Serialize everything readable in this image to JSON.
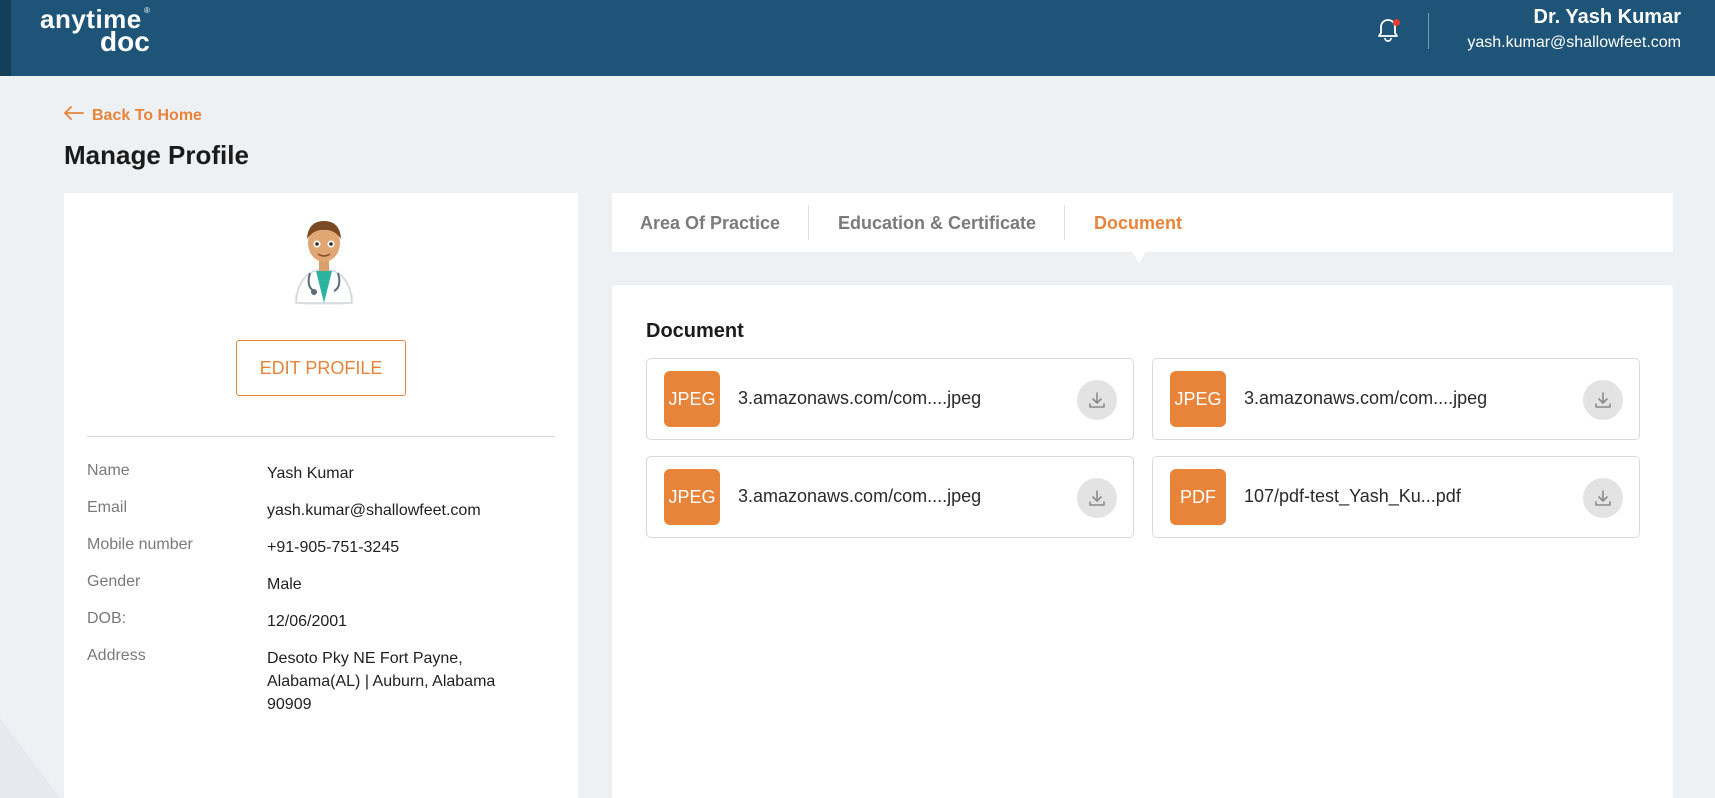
{
  "header": {
    "logo_line1": "anytime",
    "logo_line2": "doc",
    "user_name": "Dr. Yash Kumar",
    "user_email": "yash.kumar@shallowfeet.com"
  },
  "page": {
    "back_label": "Back To Home",
    "title": "Manage Profile"
  },
  "profile": {
    "edit_label": "EDIT PROFILE",
    "fields": [
      {
        "label": "Name",
        "value": "Yash Kumar"
      },
      {
        "label": "Email",
        "value": "yash.kumar@shallowfeet.com"
      },
      {
        "label": "Mobile number",
        "value": "+91-905-751-3245"
      },
      {
        "label": "Gender",
        "value": "Male"
      },
      {
        "label": "DOB:",
        "value": "12/06/2001"
      },
      {
        "label": "Address",
        "value": "Desoto Pky NE Fort Payne, Alabama(AL) | Auburn, Alabama 90909"
      }
    ]
  },
  "tabs": [
    {
      "label": "Area Of Practice",
      "active": false
    },
    {
      "label": "Education & Certificate",
      "active": false
    },
    {
      "label": "Document",
      "active": true
    }
  ],
  "documents": {
    "heading": "Document",
    "items": [
      {
        "type": "JPEG",
        "name": "3.amazonaws.com/com....jpeg"
      },
      {
        "type": "JPEG",
        "name": "3.amazonaws.com/com....jpeg"
      },
      {
        "type": "JPEG",
        "name": "3.amazonaws.com/com....jpeg"
      },
      {
        "type": "PDF",
        "name": "107/pdf-test_Yash_Ku...pdf"
      }
    ]
  },
  "colors": {
    "header_bg": "#1e5478",
    "accent": "#e8843a",
    "page_bg": "#eef1f4"
  },
  "icons": [
    "bell-icon",
    "arrow-left-icon",
    "download-icon",
    "doctor-avatar"
  ]
}
